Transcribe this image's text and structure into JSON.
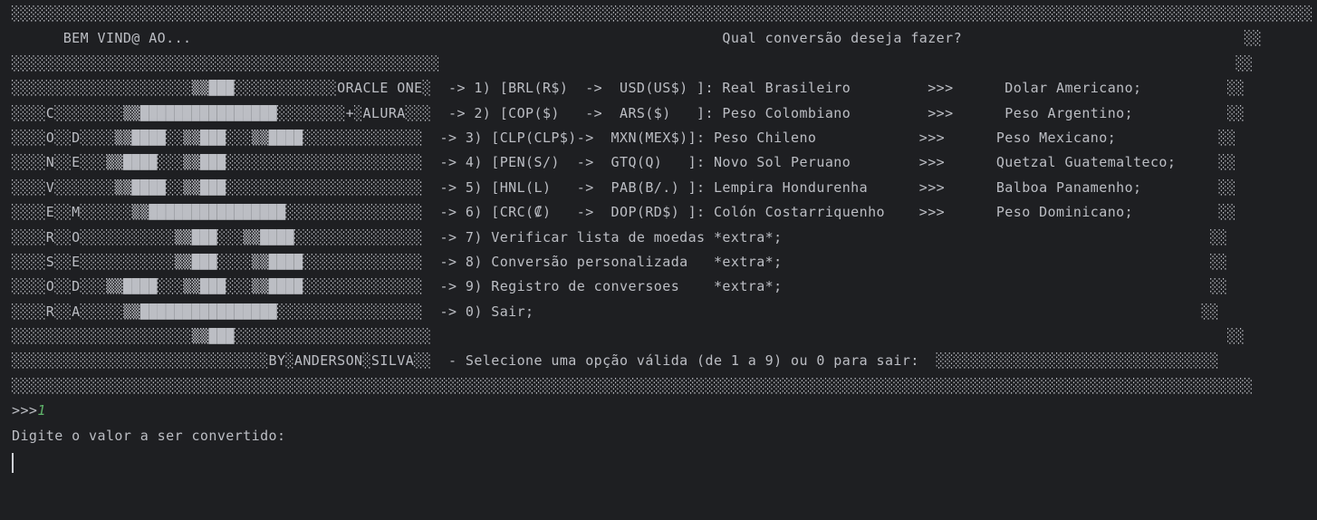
{
  "colors": {
    "background": "#1e1f22",
    "text": "#bcbec4",
    "input_echo": "#5fb36a",
    "caret": "#cfd1d6"
  },
  "console": {
    "lines": [
      "░░░░░░░░░░░░░░░░░░░░░░░░░░░░░░░░░░░░░░░░░░░░░░░░░░░░░░░░░░░░░░░░░░░░░░░░░░░░░░░░░░░░░░░░░░░░░░░░░░░░░░░░░░░░░░░░░░░░░░░░░░░░░░░░░░░░░░░░░░░░░░░░░░░░░░░░",
      "      BEM VIND@ AO...                                                              Qual conversão deseja fazer?                                 ░░",
      "░░░░░░░░░░░░░░░░░░░░░░░░░░░░░░░░░░░░░░░░░░░░░░░░░░                                                                                             ░░",
      "░░░░░░░░░░░░░░░░░░░░░▒▒███░░░░░░░░░░░░ORACLE ONE░  -> 1) [BRL(R$)  ->  USD(US$) ]: Real Brasileiro         >>>      Dolar Americano;          ░░",
      "░░░░C░░░░░░░░▒▒████████████████░░░░░░░░+░ALURA░░░  -> 2) [COP($)   ->  ARS($)   ]: Peso Colombiano         >>>      Peso Argentino;           ░░",
      "░░░░O░░D░░░░▒▒████░░▒▒███░░░▒▒████░░░░░░░░░░░░░░  -> 3) [CLP(CLP$)->  MXN(MEX$)]: Peso Chileno            >>>      Peso Mexicano;            ░░",
      "░░░░N░░E░░░▒▒████░░░▒▒███░░░░░░░░░░░░░░░░░░░░░░░  -> 4) [PEN(S/)  ->  GTQ(Q)   ]: Novo Sol Peruano        >>>      Quetzal Guatemalteco;     ░░",
      "░░░░V░░░░░░░▒▒████░░▒▒███░░░░░░░░░░░░░░░░░░░░░░░  -> 5) [HNL(L)   ->  PAB(B/.) ]: Lempira Hondurenha      >>>      Balboa Panamenho;         ░░",
      "░░░░E░░M░░░░░░▒▒████████████████░░░░░░░░░░░░░░░░  -> 6) [CRC(₡)   ->  DOP(RD$) ]: Colón Costarriquenho    >>>      Peso Dominicano;          ░░",
      "░░░░R░░O░░░░░░░░░░░▒▒███░░░▒▒████░░░░░░░░░░░░░░░  -> 7) Verificar lista de moedas *extra*;                                                  ░░",
      "░░░░S░░E░░░░░░░░░░░▒▒███░░░░▒▒████░░░░░░░░░░░░░░  -> 8) Conversão personalizada   *extra*;                                                  ░░",
      "░░░░O░░D░░░▒▒████░░░▒▒███░░░▒▒████░░░░░░░░░░░░░░  -> 9) Registro de conversoes    *extra*;                                                  ░░",
      "░░░░R░░A░░░░░▒▒████████████████░░░░░░░░░░░░░░░░░  -> 0) Sair;                                                                              ░░",
      "░░░░░░░░░░░░░░░░░░░░░▒▒███░░░░░░░░░░░░░░░░░░░░░░░                                                                                             ░░",
      "░░░░░░░░░░░░░░░░░░░░░░░░░░░░░░BY░ANDERSON░SILVA░░  - Selecione uma opção válida (de 1 a 9) ou 0 para sair:  ░░░░░░░░░░░░░░░░░░░░░░░░░░░░░░░░░",
      "░░░░░░░░░░░░░░░░░░░░░░░░░░░░░░░░░░░░░░░░░░░░░░░░░░░░░░░░░░░░░░░░░░░░░░░░░░░░░░░░░░░░░░░░░░░░░░░░░░░░░░░░░░░░░░░░░░░░░░░░░░░░░░░░░░░░░░░░░░░░░░░░░"
    ],
    "prompt": ">>>",
    "user_input": "1",
    "message": "Digite o valor a ser convertido:"
  }
}
